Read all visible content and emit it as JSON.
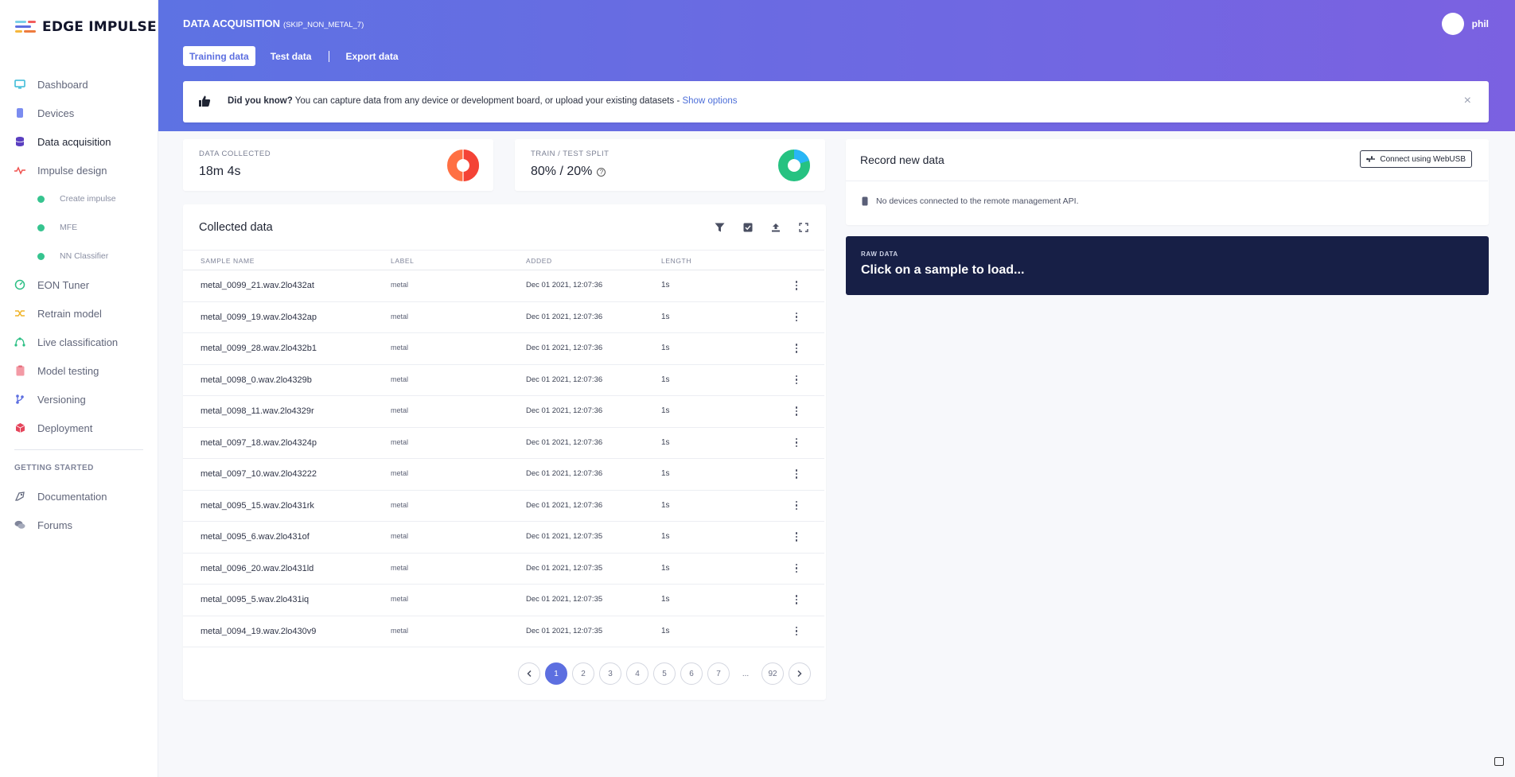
{
  "brand": {
    "name": "EDGE IMPULSE"
  },
  "sidebar": {
    "items": [
      {
        "label": "Dashboard",
        "icon": "monitor-icon"
      },
      {
        "label": "Devices",
        "icon": "chip-icon"
      },
      {
        "label": "Data acquisition",
        "icon": "database-icon"
      },
      {
        "label": "Impulse design",
        "icon": "pulse-icon"
      },
      {
        "label": "Create impulse"
      },
      {
        "label": "MFE"
      },
      {
        "label": "NN Classifier"
      },
      {
        "label": "EON Tuner",
        "icon": "tuner-icon"
      },
      {
        "label": "Retrain model",
        "icon": "shuffle-icon"
      },
      {
        "label": "Live classification",
        "icon": "branch-icon"
      },
      {
        "label": "Model testing",
        "icon": "clipboard-icon"
      },
      {
        "label": "Versioning",
        "icon": "git-icon"
      },
      {
        "label": "Deployment",
        "icon": "box-icon"
      }
    ],
    "getting_started_label": "GETTING STARTED",
    "help": [
      {
        "label": "Documentation",
        "icon": "docs-icon"
      },
      {
        "label": "Forums",
        "icon": "chat-icon"
      }
    ]
  },
  "header": {
    "title": "DATA ACQUISITION",
    "project": "(SKIP_NON_METAL_7)",
    "tabs": [
      "Training data",
      "Test data",
      "Export data"
    ],
    "username": "phil"
  },
  "banner": {
    "lead": "Did you know?",
    "text": " You can capture data from any device or development board, or upload your existing datasets - ",
    "link": "Show options"
  },
  "stats": {
    "collected_label": "DATA COLLECTED",
    "collected_value": "18m 4s",
    "split_label": "TRAIN / TEST SPLIT",
    "split_value": "80% / 20%",
    "split_train_fraction": 0.8
  },
  "collected": {
    "title": "Collected data",
    "columns": [
      "SAMPLE NAME",
      "LABEL",
      "ADDED",
      "LENGTH"
    ],
    "rows": [
      {
        "name": "metal_0099_21.wav.2lo432at",
        "label": "metal",
        "added": "Dec 01 2021, 12:07:36",
        "length": "1s"
      },
      {
        "name": "metal_0099_19.wav.2lo432ap",
        "label": "metal",
        "added": "Dec 01 2021, 12:07:36",
        "length": "1s"
      },
      {
        "name": "metal_0099_28.wav.2lo432b1",
        "label": "metal",
        "added": "Dec 01 2021, 12:07:36",
        "length": "1s"
      },
      {
        "name": "metal_0098_0.wav.2lo4329b",
        "label": "metal",
        "added": "Dec 01 2021, 12:07:36",
        "length": "1s"
      },
      {
        "name": "metal_0098_11.wav.2lo4329r",
        "label": "metal",
        "added": "Dec 01 2021, 12:07:36",
        "length": "1s"
      },
      {
        "name": "metal_0097_18.wav.2lo4324p",
        "label": "metal",
        "added": "Dec 01 2021, 12:07:36",
        "length": "1s"
      },
      {
        "name": "metal_0097_10.wav.2lo43222",
        "label": "metal",
        "added": "Dec 01 2021, 12:07:36",
        "length": "1s"
      },
      {
        "name": "metal_0095_15.wav.2lo431rk",
        "label": "metal",
        "added": "Dec 01 2021, 12:07:36",
        "length": "1s"
      },
      {
        "name": "metal_0095_6.wav.2lo431of",
        "label": "metal",
        "added": "Dec 01 2021, 12:07:35",
        "length": "1s"
      },
      {
        "name": "metal_0096_20.wav.2lo431ld",
        "label": "metal",
        "added": "Dec 01 2021, 12:07:35",
        "length": "1s"
      },
      {
        "name": "metal_0095_5.wav.2lo431iq",
        "label": "metal",
        "added": "Dec 01 2021, 12:07:35",
        "length": "1s"
      },
      {
        "name": "metal_0094_19.wav.2lo430v9",
        "label": "metal",
        "added": "Dec 01 2021, 12:07:35",
        "length": "1s"
      }
    ],
    "pages": [
      "1",
      "2",
      "3",
      "4",
      "5",
      "6",
      "7",
      "...",
      "92"
    ],
    "current_page": "1"
  },
  "record": {
    "title": "Record new data",
    "connect_label": "Connect using WebUSB",
    "message": "No devices connected to the remote management API."
  },
  "raw": {
    "label": "RAW DATA",
    "text": "Click on a sample to load..."
  },
  "colors": {
    "header_start": "#5d72e3",
    "header_end": "#7b61e1",
    "accent": "#5d6fe0",
    "ok_dot": "#36c48f",
    "raw_bg": "#171f46"
  }
}
